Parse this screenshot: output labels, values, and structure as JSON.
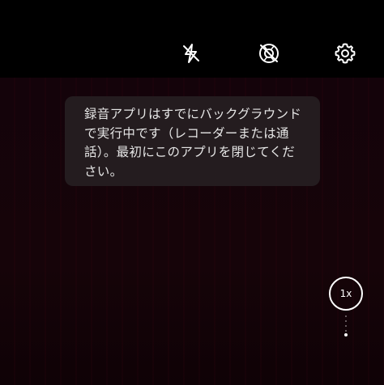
{
  "top_bar": {
    "icons": {
      "flash": "flash-off-icon",
      "live": "live-photo-off-icon",
      "settings": "gear-icon"
    }
  },
  "toast": {
    "message": "録音アプリはすでにバックグラウンドで実行中です（レコーダーまたは通話）。最初にこのアプリを閉じてください。"
  },
  "zoom": {
    "label": "1x"
  },
  "colors": {
    "background": "#000000",
    "viewfinder_tint": "#14030a",
    "toast_bg": "#261e22",
    "text": "#e6e6e6",
    "icon": "#ffffff"
  }
}
